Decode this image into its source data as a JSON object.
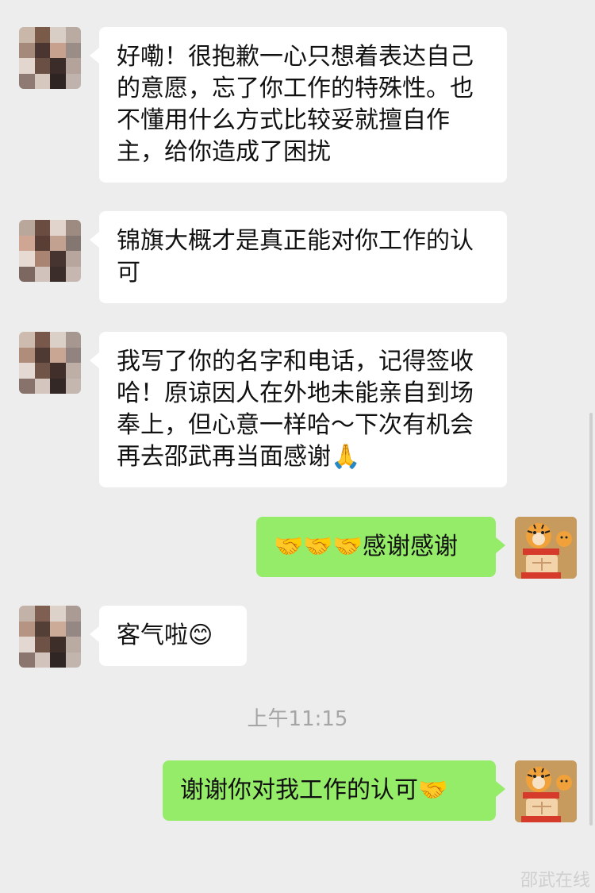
{
  "messages": [
    {
      "side": "left",
      "text": "好嘞！很抱歉一心只想着表达自己的意愿，忘了你工作的特殊性。也不懂用什么方式比较妥就擅自作主，给你造成了困扰"
    },
    {
      "side": "left",
      "text": "锦旗大概才是真正能对你工作的认可"
    },
    {
      "side": "left",
      "text": "我写了你的名字和电话，记得签收哈！原谅因人在外地未能亲自到场奉上，但心意一样哈～下次有机会再去邵武再当面感谢🙏"
    },
    {
      "side": "right",
      "text": "🤝🤝🤝感谢感谢"
    },
    {
      "side": "left",
      "text": "客气啦😊"
    },
    {
      "side": "right",
      "text": "谢谢你对我工作的认可🤝"
    }
  ],
  "timestamp": "上午11:15",
  "watermark": "邵武在线",
  "colors": {
    "background": "#ededed",
    "sent_bubble": "#95ec69",
    "received_bubble": "#ffffff"
  },
  "icons": {
    "contact_avatar": "pixelated-avatar-icon",
    "self_avatar": "tiger-avatar-icon"
  }
}
